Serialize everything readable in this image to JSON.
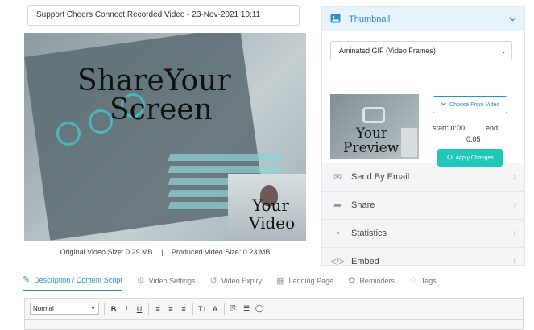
{
  "title_input": {
    "value": "Support Cheers Connect Recorded Video - 23-Nov-2021 10:11"
  },
  "video": {
    "overlay_main_line1": "ShareYour",
    "overlay_main_line2": "Screen",
    "overlay_cam_line1": "Your",
    "overlay_cam_line2": "Video"
  },
  "sizes": {
    "original": "Original Video Size: 0.29 MB",
    "divider": "|",
    "produced": "Produced Video Size: 0.23 MB"
  },
  "thumbnail": {
    "header": "Thumbnail",
    "select_value": "Aminated GIF (Video Frames)",
    "preview_line1": "Your",
    "preview_line2": "Preview",
    "choose_label": "Choose From Video",
    "start_label": "start: 0:00",
    "end_label": "end:",
    "end_value": "0:05",
    "apply_label": "Apply Changes"
  },
  "menu": [
    {
      "label": "Send By Email",
      "icon": "envelope-icon"
    },
    {
      "label": "Share",
      "icon": "share-icon"
    },
    {
      "label": "Statistics",
      "icon": "pie-chart-icon"
    },
    {
      "label": "Embed",
      "icon": "code-icon"
    }
  ],
  "tabs": [
    {
      "label": "Description / Content Script",
      "icon": "edit-icon",
      "active": true
    },
    {
      "label": "Video Settings",
      "icon": "gear-icon"
    },
    {
      "label": "Video Expiry",
      "icon": "history-icon"
    },
    {
      "label": "Landing Page",
      "icon": "calendar-icon"
    },
    {
      "label": "Reminders",
      "icon": "bug-icon"
    },
    {
      "label": "Tags",
      "icon": "tag-icon"
    }
  ],
  "editor": {
    "format_value": "Normal"
  },
  "colors": {
    "accent": "#2d8ccd",
    "apply": "#1ec7b7"
  }
}
